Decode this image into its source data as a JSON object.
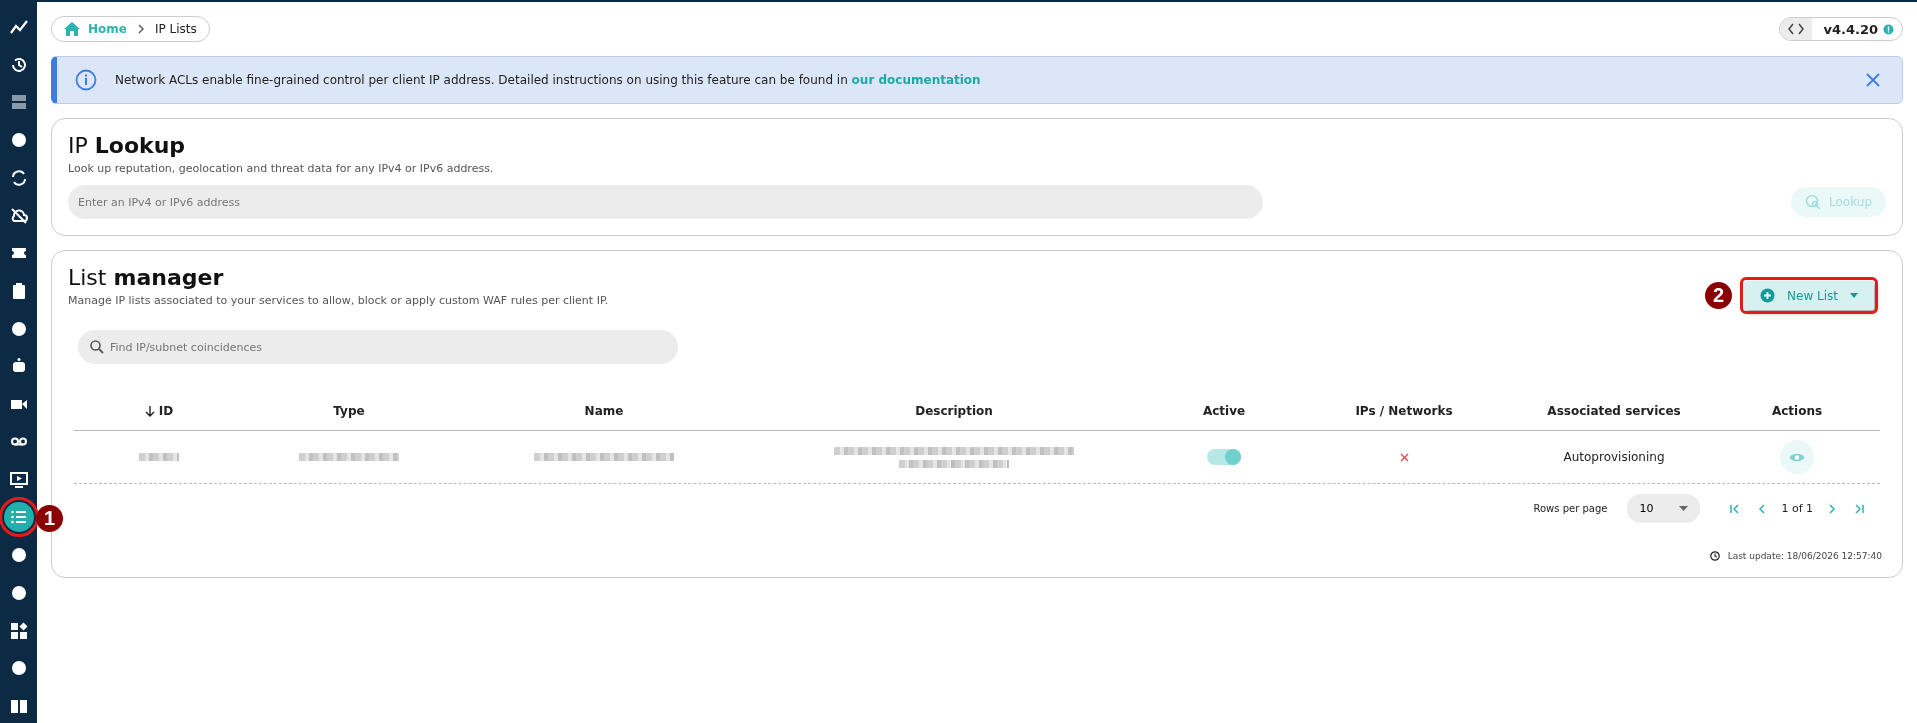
{
  "sidebar": {
    "items": [
      {
        "selected": false,
        "highlighted": false
      },
      {
        "selected": false,
        "highlighted": false
      },
      {
        "selected": false,
        "highlighted": false
      },
      {
        "selected": false,
        "highlighted": false
      },
      {
        "selected": false,
        "highlighted": false
      },
      {
        "selected": false,
        "highlighted": false
      },
      {
        "selected": false,
        "highlighted": false
      },
      {
        "selected": false,
        "highlighted": false
      },
      {
        "selected": false,
        "highlighted": false
      },
      {
        "selected": false,
        "highlighted": false
      },
      {
        "selected": false,
        "highlighted": false
      },
      {
        "selected": false,
        "highlighted": false
      },
      {
        "selected": false,
        "highlighted": false
      },
      {
        "selected": true,
        "highlighted": true,
        "callout": "1"
      },
      {
        "selected": false,
        "highlighted": false
      },
      {
        "selected": false,
        "highlighted": false
      },
      {
        "selected": false,
        "highlighted": false
      },
      {
        "selected": false,
        "highlighted": false
      },
      {
        "selected": false,
        "highlighted": false
      }
    ]
  },
  "breadcrumb": {
    "home": "Home",
    "current": "IP Lists"
  },
  "version": "v4.4.20",
  "banner": {
    "text": "Network ACLs enable fine-grained control per client IP address. Detailed instructions on using this feature can be found in",
    "link": "our documentation"
  },
  "ip_lookup": {
    "title_light": "IP",
    "title_bold": "Lookup",
    "subtitle": "Look up reputation, geolocation and threat data for any IPv4 or IPv6 address.",
    "placeholder": "Enter an IPv4 or IPv6 address",
    "button": "Lookup",
    "button_disabled": true
  },
  "list_manager": {
    "title_light": "List",
    "title_bold": "manager",
    "subtitle": "Manage IP lists associated to your services to allow, block or apply custom WAF rules per client IP.",
    "new_button": {
      "label": "New List",
      "highlighted": true,
      "callout": "2"
    },
    "search_placeholder": "Find IP/subnet coincidences",
    "table": {
      "columns": [
        {
          "label": "ID",
          "sorted": true
        },
        {
          "label": "Type",
          "sorted": false
        },
        {
          "label": "Name",
          "sorted": false
        },
        {
          "label": "Description",
          "sorted": false
        },
        {
          "label": "Active",
          "sorted": false
        },
        {
          "label": "IPs / Networks",
          "sorted": false
        },
        {
          "label": "Associated services",
          "sorted": false
        },
        {
          "label": "Actions",
          "sorted": false
        }
      ],
      "rows": [
        {
          "cells": [
            {
              "kind": "blurred"
            },
            {
              "kind": "blurred"
            },
            {
              "kind": "blurred"
            },
            {
              "kind": "blurred"
            },
            {
              "kind": "toggle",
              "on": true
            },
            {
              "kind": "cross"
            },
            {
              "kind": "text",
              "text": "Autoprovisioning"
            },
            {
              "kind": "view"
            }
          ]
        }
      ]
    },
    "pagination": {
      "rows_label": "Rows per page",
      "rows_value": "10",
      "range": "1 of 1"
    },
    "last_update": "Last update: 18/06/2026 12:57:40"
  }
}
